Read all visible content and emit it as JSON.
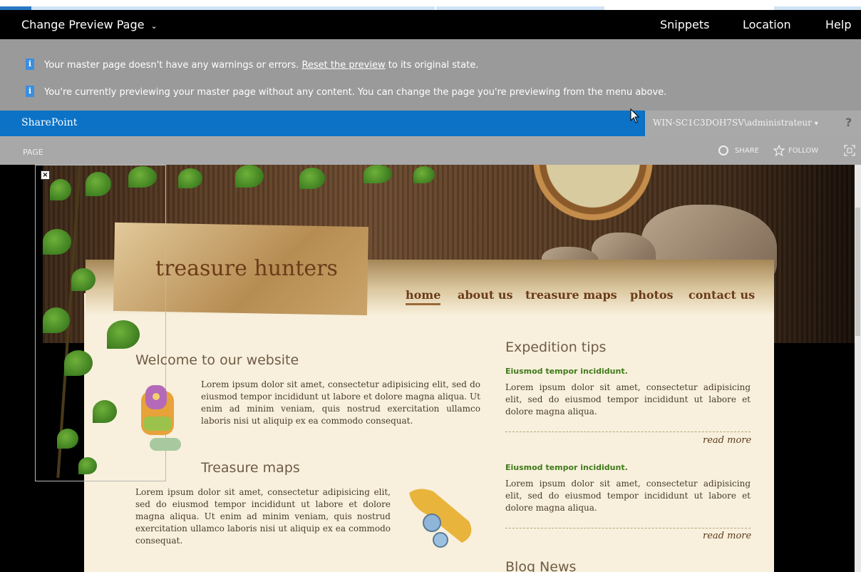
{
  "toolbar": {
    "change_preview": "Change Preview Page",
    "snippets": "Snippets",
    "location": "Location",
    "help": "Help"
  },
  "messages": {
    "msg1_before": "Your master page doesn't have any warnings or errors.",
    "msg1_link": "Reset the preview",
    "msg1_after": "to its original state.",
    "msg2": "You're currently previewing your master page without any content. You can change the page you're previewing from the menu above.",
    "info_glyph": "i"
  },
  "suitebar": {
    "brand": "SharePoint",
    "user": "WIN-SC1C3DOH7SV\\administrateur",
    "help_glyph": "?"
  },
  "ribbon": {
    "page_tab": "PAGE",
    "share": "SHARE",
    "follow": "FOLLOW"
  },
  "site": {
    "logo": "treasure hunters",
    "nav": [
      "home",
      "about us",
      "treasure maps",
      "photos",
      "contact us"
    ],
    "welcome_title": "Welcome to our website",
    "welcome_text": "Lorem ipsum dolor sit amet, consectetur adipisicing elit, sed do eiusmod tempor incididunt ut labore et dolore magna aliqua. Ut enim ad minim veniam, quis nostrud exercitation ullamco laboris nisi ut aliquip ex ea commodo consequat.",
    "maps_title": "Treasure maps",
    "maps_text": "Lorem ipsum dolor sit amet, consectetur adipisicing elit, sed do eiusmod tempor incididunt ut labore et dolore magna aliqua. Ut enim ad minim veniam, quis nostrud exercitation ullamco laboris nisi ut aliquip ex ea commodo consequat.",
    "tips_title": "Expedition tips",
    "tips": [
      {
        "heading": "Eiusmod tempor incididunt.",
        "text": "Lorem ipsum dolor sit amet, consectetur adipisicing elit, sed do eiusmod tempor incididunt ut labore et dolore magna aliqua.",
        "more": "read more"
      },
      {
        "heading": "Eiusmod tempor incididunt.",
        "text": "Lorem ipsum dolor sit amet, consectetur adipisicing elit, sed do eiusmod tempor incididunt ut labore et dolore magna aliqua.",
        "more": "read more"
      }
    ],
    "blog_title": "Blog News"
  },
  "colors": {
    "suitebar_blue": "#0b72c6",
    "info_gray": "#9a9a9a",
    "content_bg": "#f8f0dc",
    "accent_green": "#3f7a1a"
  },
  "icons": {
    "close": "×",
    "share": "share-icon",
    "follow": "star-icon",
    "focus": "focus-mode-icon",
    "cursor": "mouse-pointer-icon",
    "dropdown": "chevron-down-icon"
  }
}
